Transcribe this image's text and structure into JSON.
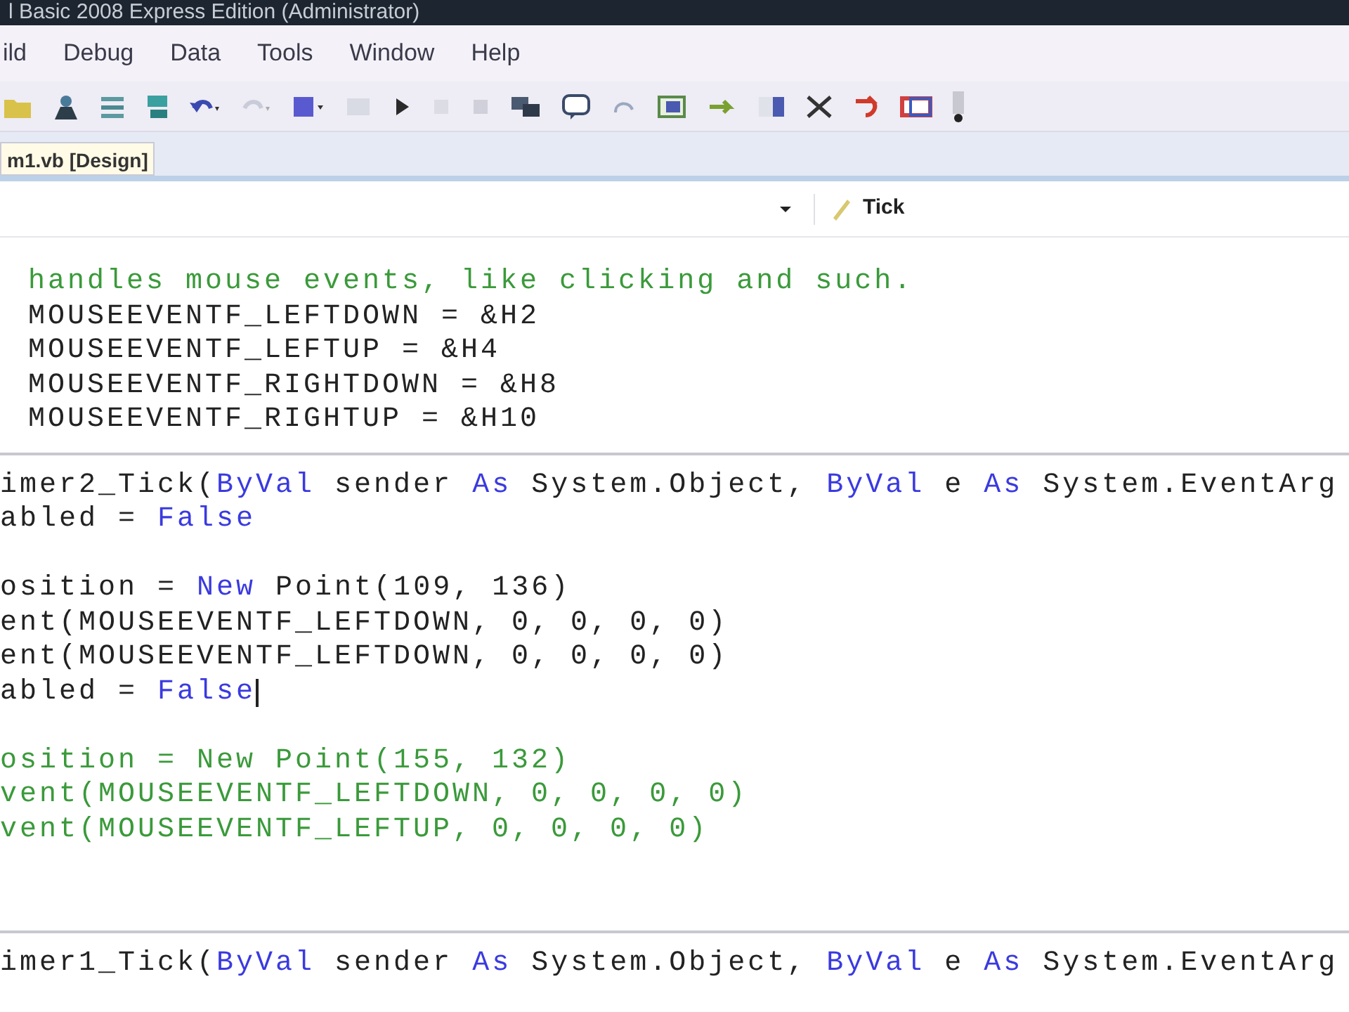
{
  "window": {
    "title": "l Basic 2008 Express Edition (Administrator)"
  },
  "menu": [
    {
      "label": "ild"
    },
    {
      "label": "Debug"
    },
    {
      "label": "Data"
    },
    {
      "label": "Tools"
    },
    {
      "label": "Window"
    },
    {
      "label": "Help"
    }
  ],
  "tabs": [
    {
      "label": "m1.vb [Design]",
      "selected": true
    }
  ],
  "navigation": {
    "method_dropdown": "Tick"
  },
  "code": {
    "blocks": [
      {
        "kind": "declarations",
        "lines": [
          {
            "kind": "code",
            "segments": [
              {
                "kind": "comment",
                "text": "handles mouse events, like clicking and such."
              }
            ]
          },
          {
            "kind": "code",
            "segments": [
              {
                "kind": "plain",
                "text": "MOUSEEVENTF_LEFTDOWN = &H2"
              }
            ]
          },
          {
            "kind": "code",
            "segments": [
              {
                "kind": "plain",
                "text": "MOUSEEVENTF_LEFTUP = &H4"
              }
            ]
          },
          {
            "kind": "code",
            "segments": [
              {
                "kind": "plain",
                "text": "MOUSEEVENTF_RIGHTDOWN = &H8"
              }
            ]
          },
          {
            "kind": "code",
            "segments": [
              {
                "kind": "plain",
                "text": "MOUSEEVENTF_RIGHTUP = &H10"
              }
            ]
          }
        ]
      },
      {
        "kind": "method",
        "lines": [
          {
            "kind": "code",
            "segments": [
              {
                "kind": "plain",
                "text": "imer2_Tick("
              },
              {
                "kind": "keyword",
                "text": "ByVal"
              },
              {
                "kind": "plain",
                "text": " sender "
              },
              {
                "kind": "keyword",
                "text": "As"
              },
              {
                "kind": "plain",
                "text": " System.Object, "
              },
              {
                "kind": "keyword",
                "text": "ByVal"
              },
              {
                "kind": "plain",
                "text": " e "
              },
              {
                "kind": "keyword",
                "text": "As"
              },
              {
                "kind": "plain",
                "text": " System.EventArg"
              }
            ]
          },
          {
            "kind": "code",
            "segments": [
              {
                "kind": "plain",
                "text": "abled = "
              },
              {
                "kind": "keyword",
                "text": "False"
              }
            ]
          },
          {
            "kind": "blank"
          },
          {
            "kind": "code",
            "segments": [
              {
                "kind": "plain",
                "text": "osition = "
              },
              {
                "kind": "keyword",
                "text": "New"
              },
              {
                "kind": "plain",
                "text": " Point(109, 136)"
              }
            ]
          },
          {
            "kind": "code",
            "segments": [
              {
                "kind": "plain",
                "text": "ent(MOUSEEVENTF_LEFTDOWN, 0, 0, 0, 0)"
              }
            ]
          },
          {
            "kind": "code",
            "segments": [
              {
                "kind": "plain",
                "text": "ent(MOUSEEVENTF_LEFTDOWN, 0, 0, 0, 0)"
              }
            ]
          },
          {
            "kind": "code",
            "segments": [
              {
                "kind": "plain",
                "text": "abled = "
              },
              {
                "kind": "keyword",
                "text": "False"
              }
            ],
            "caret": true
          },
          {
            "kind": "blank"
          },
          {
            "kind": "code",
            "segments": [
              {
                "kind": "comment",
                "text": "osition = New Point(155, 132)"
              }
            ]
          },
          {
            "kind": "code",
            "segments": [
              {
                "kind": "comment",
                "text": "vent(MOUSEEVENTF_LEFTDOWN, 0, 0, 0, 0)"
              }
            ]
          },
          {
            "kind": "code",
            "segments": [
              {
                "kind": "comment",
                "text": "vent(MOUSEEVENTF_LEFTUP, 0, 0, 0, 0)"
              }
            ]
          },
          {
            "kind": "blank"
          },
          {
            "kind": "blank"
          }
        ]
      },
      {
        "kind": "method",
        "lines": [
          {
            "kind": "code",
            "segments": [
              {
                "kind": "plain",
                "text": "imer1_Tick("
              },
              {
                "kind": "keyword",
                "text": "ByVal"
              },
              {
                "kind": "plain",
                "text": " sender "
              },
              {
                "kind": "keyword",
                "text": "As"
              },
              {
                "kind": "plain",
                "text": " System.Object, "
              },
              {
                "kind": "keyword",
                "text": "ByVal"
              },
              {
                "kind": "plain",
                "text": " e "
              },
              {
                "kind": "keyword",
                "text": "As"
              },
              {
                "kind": "plain",
                "text": " System.EventArg"
              }
            ]
          }
        ]
      }
    ]
  }
}
